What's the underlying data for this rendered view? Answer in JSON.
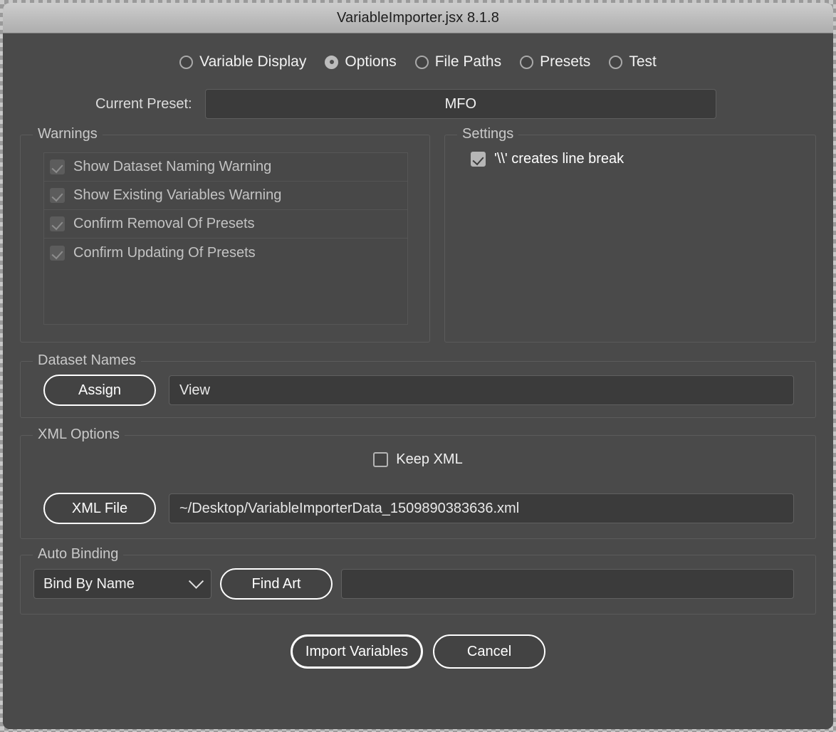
{
  "window": {
    "title": "VariableImporter.jsx 8.1.8"
  },
  "tabs": [
    {
      "label": "Variable Display",
      "selected": false,
      "name": "tab-variable-display"
    },
    {
      "label": "Options",
      "selected": true,
      "name": "tab-options"
    },
    {
      "label": "File Paths",
      "selected": false,
      "name": "tab-file-paths"
    },
    {
      "label": "Presets",
      "selected": false,
      "name": "tab-presets"
    },
    {
      "label": "Test",
      "selected": false,
      "name": "tab-test"
    }
  ],
  "preset": {
    "label": "Current Preset:",
    "value": "MFO"
  },
  "warnings": {
    "title": "Warnings",
    "items": [
      {
        "label": "Show Dataset Naming Warning",
        "checked": true
      },
      {
        "label": "Show Existing Variables Warning",
        "checked": true
      },
      {
        "label": "Confirm Removal Of Presets",
        "checked": true
      },
      {
        "label": "Confirm Updating Of Presets",
        "checked": true
      }
    ]
  },
  "settings": {
    "title": "Settings",
    "line_break_label": "'\\\\' creates line break",
    "line_break_checked": true
  },
  "dataset_names": {
    "title": "Dataset Names",
    "assign_button": "Assign",
    "value": "View"
  },
  "xml_options": {
    "title": "XML Options",
    "keep_xml_label": "Keep XML",
    "keep_xml_checked": false,
    "xml_file_button": "XML File",
    "xml_file_path": "~/Desktop/VariableImporterData_1509890383636.xml"
  },
  "auto_binding": {
    "title": "Auto Binding",
    "mode": "Bind By Name",
    "find_art_button": "Find Art",
    "art_value": ""
  },
  "footer": {
    "import_button": "Import Variables",
    "cancel_button": "Cancel"
  },
  "colors": {
    "window_bg": "#4a4a4a",
    "titlebar": "#bdbdbd",
    "field_bg": "#3b3b3b",
    "accent_border": "#ffffff"
  }
}
